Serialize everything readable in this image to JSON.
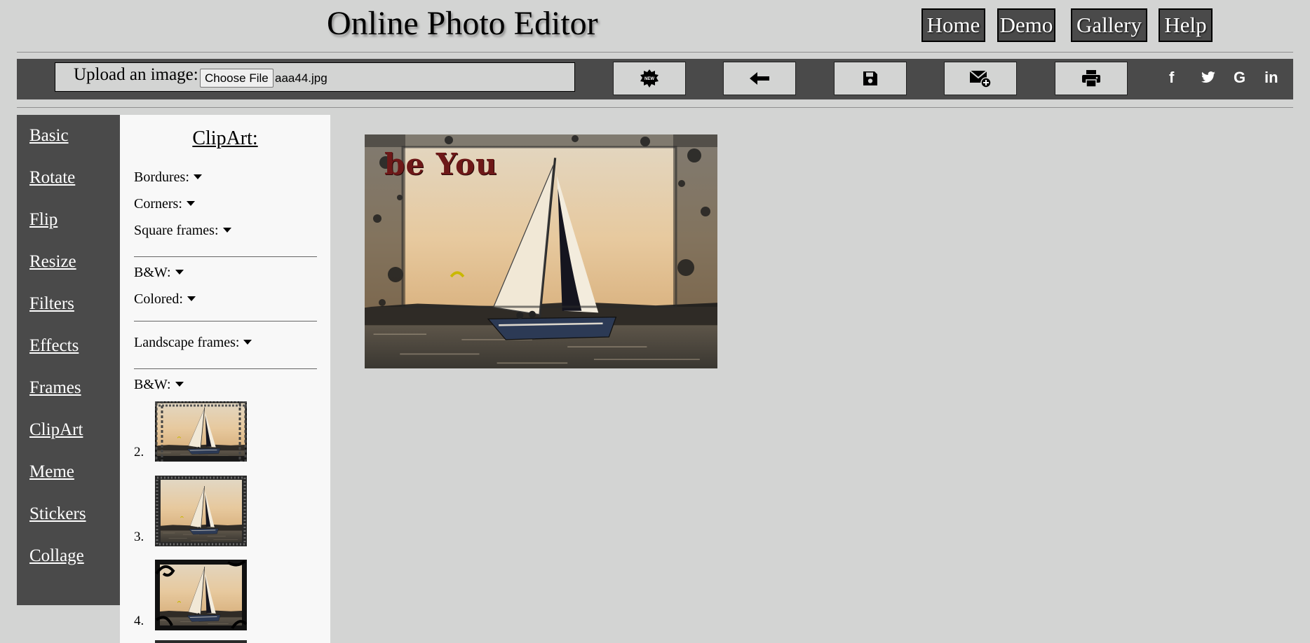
{
  "header": {
    "title": "Online Photo Editor",
    "nav": [
      "Home",
      "Demo",
      "Gallery",
      "Help"
    ]
  },
  "toolbar": {
    "upload_label": "Upload an image:",
    "choose_file_label": "Choose File",
    "file_name": "aaa44.jpg",
    "new_badge": "NEW",
    "tools": [
      "new-icon",
      "undo-arrow-icon",
      "save-icon",
      "email-icon",
      "print-icon"
    ],
    "social": {
      "facebook": "f",
      "google": "G",
      "linkedin": "in",
      "twitter_icon": "twitter-icon"
    }
  },
  "sidebar": {
    "items": [
      "Basic",
      "Rotate",
      "Flip",
      "Resize",
      "Filters",
      "Effects",
      "Frames",
      "ClipArt",
      "Meme",
      "Stickers",
      "Collage"
    ]
  },
  "clipart": {
    "heading": "ClipArt:",
    "dropdowns": {
      "bordures": "Bordures:",
      "corners": "Corners:",
      "square_frames": "Square frames:",
      "square_bw": "B&W:",
      "square_colored": "Colored:",
      "landscape_frames": "Landscape frames:",
      "landscape_bw": "B&W:"
    },
    "thumbnails": [
      {
        "number": "2."
      },
      {
        "number": "3."
      },
      {
        "number": "4."
      }
    ]
  },
  "canvas": {
    "overlay_text": "be You"
  },
  "colors": {
    "background": "#d3d4d3",
    "toolbar": "#4a4a4a",
    "panel": "#f8f8f8",
    "overlay_text": "#6e1818"
  }
}
